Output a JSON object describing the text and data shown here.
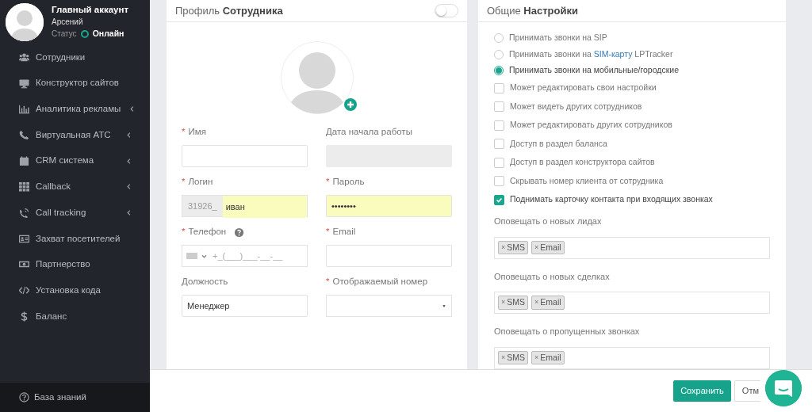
{
  "sidebar": {
    "account": {
      "title": "Главный аккаунт",
      "user": "Арсений",
      "status_label": "Статус",
      "status": "Онлайн",
      "online": true
    },
    "items": [
      {
        "label": "Сотрудники",
        "has_submenu": false
      },
      {
        "label": "Конструктор сайтов",
        "has_submenu": false
      },
      {
        "label": "Аналитика рекламы",
        "has_submenu": true
      },
      {
        "label": "Виртуальная АТС",
        "has_submenu": true
      },
      {
        "label": "CRM система",
        "has_submenu": true
      },
      {
        "label": "Callback",
        "has_submenu": true
      },
      {
        "label": "Call tracking",
        "has_submenu": true
      },
      {
        "label": "Захват посетителей",
        "has_submenu": false
      },
      {
        "label": "Партнерство",
        "has_submenu": false
      },
      {
        "label": "Установка кода",
        "has_submenu": false
      },
      {
        "label": "Баланс",
        "has_submenu": false
      }
    ],
    "footer": {
      "label": "База знаний"
    }
  },
  "profile": {
    "title": "Профиль",
    "title_bold": "Сотрудника",
    "toggle_on": false,
    "required_mark": "*",
    "fields": [
      {
        "kind": "text",
        "label": "Имя",
        "required": true
      },
      {
        "kind": "disabled",
        "label": "Дата начала работы",
        "required": false
      },
      {
        "kind": "login",
        "label": "Логин",
        "required": true,
        "prefix": "31926_",
        "value": "иван",
        "autofilled": true
      },
      {
        "kind": "password",
        "label": "Пароль",
        "required": true,
        "value": "••••••••",
        "autofilled": true
      },
      {
        "kind": "phone",
        "label": "Телефон",
        "required": true,
        "help": true,
        "placeholder": "+_(___)___-__-__"
      },
      {
        "kind": "text",
        "label": "Email",
        "required": true
      },
      {
        "kind": "text",
        "label": "Должность",
        "required": false,
        "value": "Менеджер"
      },
      {
        "kind": "select",
        "label": "Отображаемый номер",
        "required": true
      }
    ]
  },
  "settings": {
    "title": "Общие",
    "title_bold": "Настройки",
    "options": [
      {
        "kind": "radio",
        "label": "Принимать звонки на SIP",
        "selected": false
      },
      {
        "kind": "radio",
        "label": "Принимать звонки на ",
        "link": "SIM-карту",
        "label_after": " LPTracker",
        "selected": false
      },
      {
        "kind": "radio",
        "label": "Принимать звонки на мобильные/городские",
        "selected": true
      },
      {
        "kind": "checkbox",
        "label": "Может редактировать свои настройки",
        "checked": false
      },
      {
        "kind": "checkbox",
        "label": "Может видеть других сотрудников",
        "checked": false
      },
      {
        "kind": "checkbox",
        "label": "Может редактировать других сотрудников",
        "checked": false
      },
      {
        "kind": "checkbox",
        "label": "Доступ в раздел баланса",
        "checked": false
      },
      {
        "kind": "checkbox",
        "label": "Доступ в раздел конструктора сайтов",
        "checked": false
      },
      {
        "kind": "checkbox",
        "label": "Скрывать номер клиента от сотрудника",
        "checked": false
      },
      {
        "kind": "checkbox",
        "label": "Поднимать карточку контакта при входящих звонках",
        "checked": true
      }
    ],
    "notifications": [
      {
        "label": "Оповещать о новых лидах",
        "tags": [
          "SMS",
          "Email"
        ]
      },
      {
        "label": "Оповещать о новых сделках",
        "tags": [
          "SMS",
          "Email"
        ]
      },
      {
        "label": "Оповещать о пропущенных звонках",
        "tags": [
          "SMS",
          "Email"
        ]
      }
    ],
    "tag_remove": "×"
  },
  "footer": {
    "buttons": [
      {
        "kind": "primary",
        "label": "Сохранить"
      },
      {
        "kind": "secondary",
        "label": "Отм"
      }
    ]
  }
}
